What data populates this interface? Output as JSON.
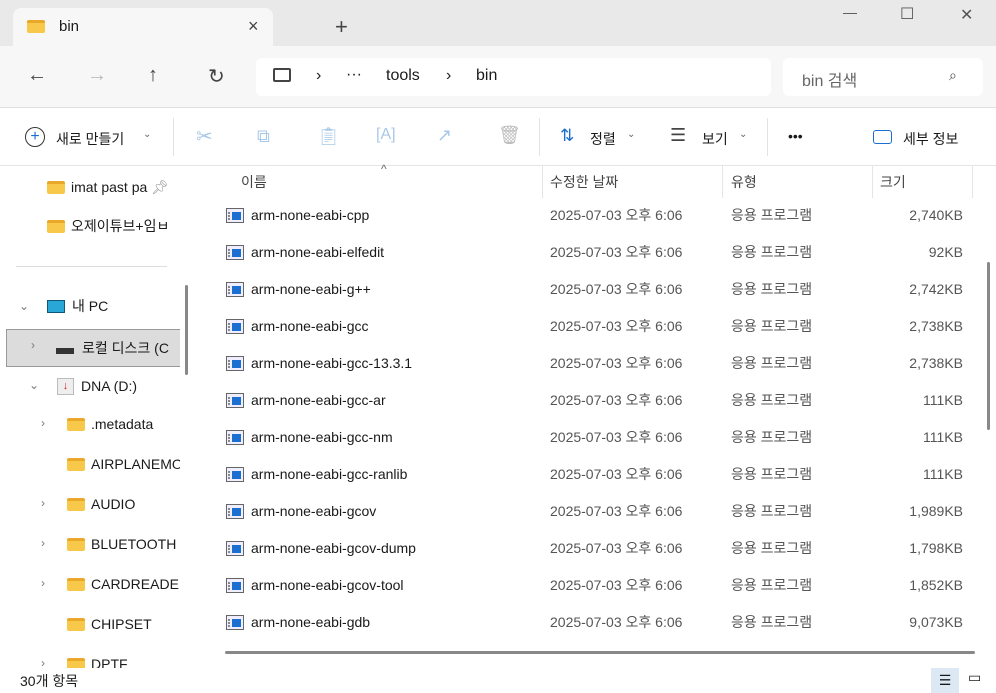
{
  "window": {
    "tab_title": "bin",
    "new_tab": "+",
    "close_tab": "×",
    "minimize": "—",
    "maximize": "☐",
    "close": "✕"
  },
  "nav": {
    "back": "←",
    "forward": "→",
    "up": "↑",
    "refresh": "↻",
    "breadcrumb": [
      "tools",
      "bin"
    ],
    "ellipsis": "···",
    "search_placeholder": "bin 검색"
  },
  "toolbar": {
    "new": "새로 만들기",
    "sort": "정렬",
    "view": "보기",
    "more": "•••",
    "details": "세부 정보"
  },
  "sidebar": {
    "pinned": [
      {
        "label": "imat past pa"
      },
      {
        "label": "오제이튜브+임ㅂ"
      }
    ],
    "this_pc": "내 PC",
    "local_disk": "로컬 디스크 (C",
    "dna": "DNA (D:)",
    "folders": [
      {
        "label": ".metadata",
        "expand": true
      },
      {
        "label": "AIRPLANEMO",
        "expand": false
      },
      {
        "label": "AUDIO",
        "expand": true
      },
      {
        "label": "BLUETOOTH",
        "expand": true
      },
      {
        "label": "CARDREADE",
        "expand": true
      },
      {
        "label": "CHIPSET",
        "expand": false
      },
      {
        "label": "DPTF",
        "expand": true
      }
    ]
  },
  "columns": {
    "name": "이름",
    "date": "수정한 날짜",
    "type": "유형",
    "size": "크기"
  },
  "files": [
    {
      "name": "arm-none-eabi-cpp",
      "date": "2025-07-03 오후 6:06",
      "type": "응용 프로그램",
      "size": "2,740KB"
    },
    {
      "name": "arm-none-eabi-elfedit",
      "date": "2025-07-03 오후 6:06",
      "type": "응용 프로그램",
      "size": "92KB"
    },
    {
      "name": "arm-none-eabi-g++",
      "date": "2025-07-03 오후 6:06",
      "type": "응용 프로그램",
      "size": "2,742KB"
    },
    {
      "name": "arm-none-eabi-gcc",
      "date": "2025-07-03 오후 6:06",
      "type": "응용 프로그램",
      "size": "2,738KB"
    },
    {
      "name": "arm-none-eabi-gcc-13.3.1",
      "date": "2025-07-03 오후 6:06",
      "type": "응용 프로그램",
      "size": "2,738KB"
    },
    {
      "name": "arm-none-eabi-gcc-ar",
      "date": "2025-07-03 오후 6:06",
      "type": "응용 프로그램",
      "size": "111KB"
    },
    {
      "name": "arm-none-eabi-gcc-nm",
      "date": "2025-07-03 오후 6:06",
      "type": "응용 프로그램",
      "size": "111KB"
    },
    {
      "name": "arm-none-eabi-gcc-ranlib",
      "date": "2025-07-03 오후 6:06",
      "type": "응용 프로그램",
      "size": "111KB"
    },
    {
      "name": "arm-none-eabi-gcov",
      "date": "2025-07-03 오후 6:06",
      "type": "응용 프로그램",
      "size": "1,989KB"
    },
    {
      "name": "arm-none-eabi-gcov-dump",
      "date": "2025-07-03 오후 6:06",
      "type": "응용 프로그램",
      "size": "1,798KB"
    },
    {
      "name": "arm-none-eabi-gcov-tool",
      "date": "2025-07-03 오후 6:06",
      "type": "응용 프로그램",
      "size": "1,852KB"
    },
    {
      "name": "arm-none-eabi-gdb",
      "date": "2025-07-03 오후 6:06",
      "type": "응용 프로그램",
      "size": "9,073KB"
    }
  ],
  "status": {
    "count": "30개 항목"
  }
}
